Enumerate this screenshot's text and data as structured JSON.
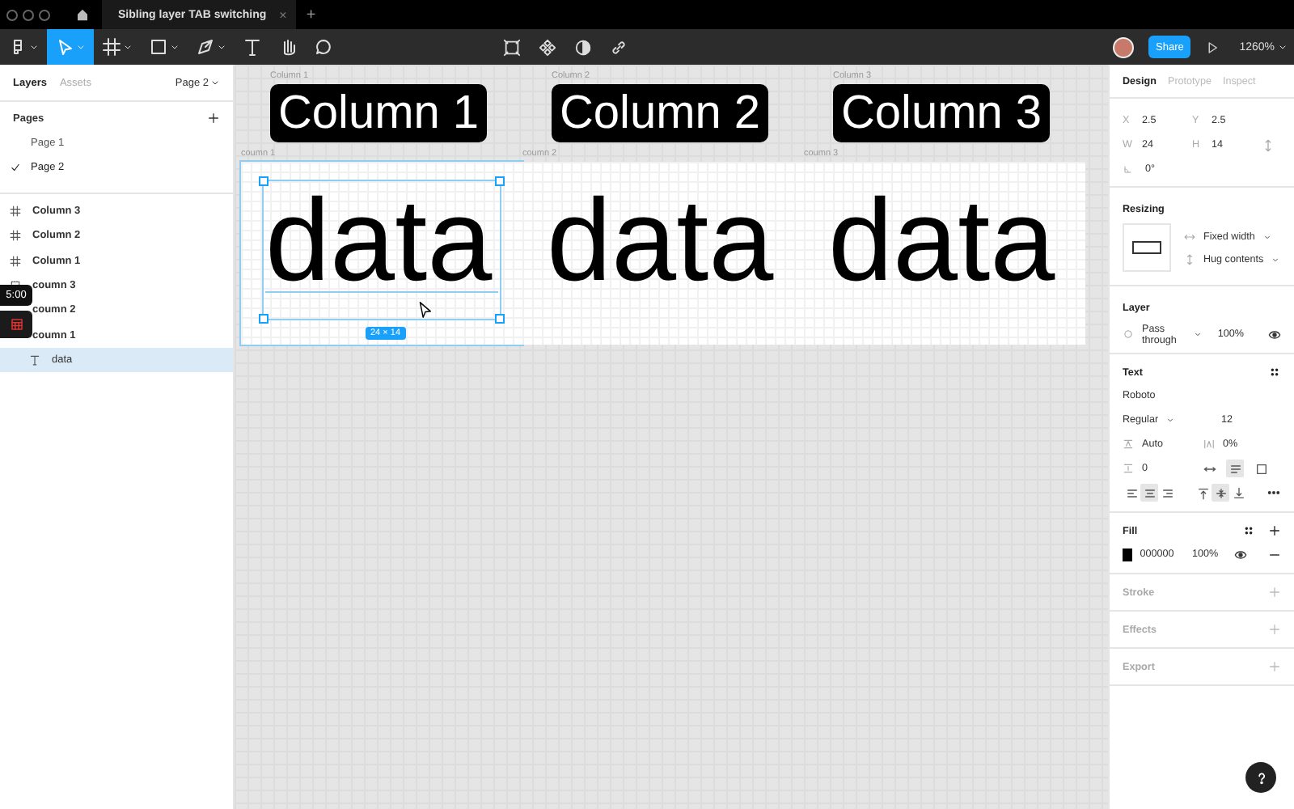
{
  "title_bar": {
    "tab_title": "Sibling layer TAB switching",
    "tab_close": "×",
    "new_tab": "+"
  },
  "toolbar": {
    "tools": [
      {
        "kind": "logo",
        "selected": false,
        "menu": true
      },
      {
        "kind": "move",
        "selected": true,
        "menu": true
      },
      {
        "kind": "frame",
        "selected": false,
        "menu": true
      },
      {
        "kind": "shape",
        "selected": false,
        "menu": true
      },
      {
        "kind": "pen",
        "selected": false,
        "menu": true
      },
      {
        "kind": "text",
        "selected": false,
        "menu": false
      },
      {
        "kind": "hand",
        "selected": false,
        "menu": false
      },
      {
        "kind": "comment",
        "selected": false,
        "menu": false
      }
    ],
    "share": "Share",
    "zoom": "1260%"
  },
  "left_panel": {
    "tabs": [
      {
        "label": "Layers",
        "selected": true
      },
      {
        "label": "Assets",
        "selected": false
      }
    ],
    "page_picker": "Page 2",
    "pages_heading": "Pages",
    "pages": [
      {
        "label": "Page 1",
        "selected": false
      },
      {
        "label": "Page 2",
        "selected": true
      }
    ],
    "layers": [
      {
        "kind": "frame",
        "label": "Column 3",
        "selected": false
      },
      {
        "kind": "frame",
        "label": "Column 2",
        "selected": false
      },
      {
        "kind": "frame",
        "label": "Column 1",
        "selected": false
      },
      {
        "kind": "grid",
        "label": "coumn 3",
        "selected": false
      },
      {
        "kind": "covered",
        "label": "coumn 2",
        "selected": false
      },
      {
        "kind": "covered",
        "label": "coumn 1",
        "selected": false,
        "children": [
          {
            "kind": "text",
            "label": "data",
            "selected": true
          }
        ]
      }
    ]
  },
  "overlay": {
    "timer": "5:00"
  },
  "canvas": {
    "headings": [
      {
        "label": "Column 1",
        "text": "Column 1"
      },
      {
        "label": "Column 2",
        "text": "Column 2"
      },
      {
        "label": "Column 3",
        "text": "Column 3"
      }
    ],
    "columns": [
      {
        "label": "coumn 1",
        "text": "data",
        "selected": true
      },
      {
        "label": "coumn 2",
        "text": "data",
        "selected": false
      },
      {
        "label": "coumn 3",
        "text": "data",
        "selected": false
      }
    ],
    "size_badge": "24 × 14"
  },
  "design_panel": {
    "tabs": [
      {
        "label": "Design",
        "selected": true
      },
      {
        "label": "Prototype",
        "selected": false
      },
      {
        "label": "Inspect",
        "selected": false
      }
    ],
    "position": [
      {
        "label": "X",
        "value": "2.5"
      },
      {
        "label": "Y",
        "value": "2.5"
      },
      {
        "label": "W",
        "value": "24"
      },
      {
        "label": "H",
        "value": "14"
      }
    ],
    "rotation": "0°",
    "resizing": {
      "title": "Resizing",
      "horizontal": "Fixed width",
      "vertical": "Hug contents"
    },
    "layer": {
      "title": "Layer",
      "blend": "Pass through",
      "opacity": "100%"
    },
    "text": {
      "title": "Text",
      "font": "Roboto",
      "style": "Regular",
      "size": "12",
      "line_height": "Auto",
      "letter_spacing": "0%",
      "paragraph_spacing": "0",
      "resize_mode": [
        {
          "selected": false
        },
        {
          "selected": true
        },
        {
          "selected": false
        }
      ],
      "align_h": [
        {
          "selected": false
        },
        {
          "selected": true
        },
        {
          "selected": false
        }
      ],
      "align_v": [
        {
          "selected": false
        },
        {
          "selected": true
        },
        {
          "selected": false
        }
      ]
    },
    "fill": {
      "title": "Fill",
      "color": "#000000",
      "hex": "000000",
      "opacity": "100%"
    },
    "sections": [
      {
        "title": "Stroke"
      },
      {
        "title": "Effects"
      },
      {
        "title": "Export"
      }
    ]
  }
}
